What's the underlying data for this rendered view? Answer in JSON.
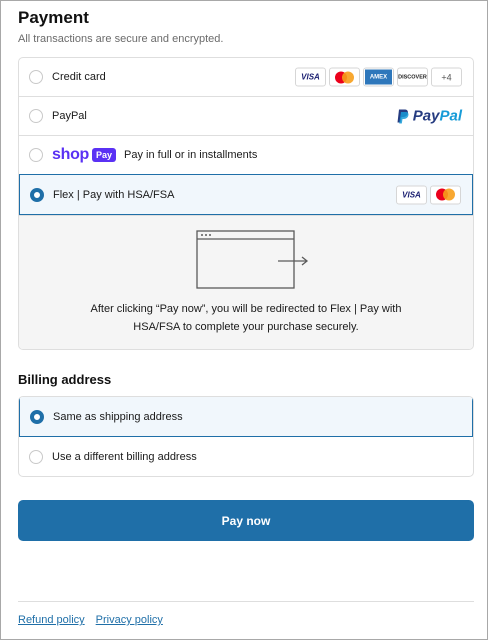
{
  "header": {
    "title": "Payment",
    "subtitle": "All transactions are secure and encrypted."
  },
  "payment_methods": [
    {
      "label": "Credit card",
      "selected": false,
      "card_brands": [
        "VISA",
        "mastercard",
        "AMEX",
        "DISCOVER",
        "+4"
      ]
    },
    {
      "label": "PayPal",
      "selected": false,
      "logo_text": [
        "Pay",
        "Pal"
      ]
    },
    {
      "label": "Pay in full or in installments",
      "selected": false,
      "logo_text": [
        "shop",
        "Pay"
      ]
    },
    {
      "label": "Flex | Pay with HSA/FSA",
      "selected": true,
      "card_brands": [
        "VISA",
        "mastercard"
      ]
    }
  ],
  "redirect_panel": {
    "icon": "browser-redirect-icon",
    "text": "After clicking “Pay now”, you will be redirected to Flex | Pay with HSA/FSA to complete your purchase securely."
  },
  "billing": {
    "title": "Billing address",
    "options": [
      {
        "label": "Same as shipping address",
        "selected": true
      },
      {
        "label": "Use a different billing address",
        "selected": false
      }
    ]
  },
  "pay_button": {
    "label": "Pay now"
  },
  "footer": {
    "links": [
      "Refund policy",
      "Privacy policy"
    ]
  },
  "colors": {
    "accent": "#1f6fa8",
    "selected_bg": "#f1f7fc",
    "shop_pay": "#5a31f4",
    "paypal_dark": "#253b80",
    "paypal_light": "#179bd7"
  }
}
